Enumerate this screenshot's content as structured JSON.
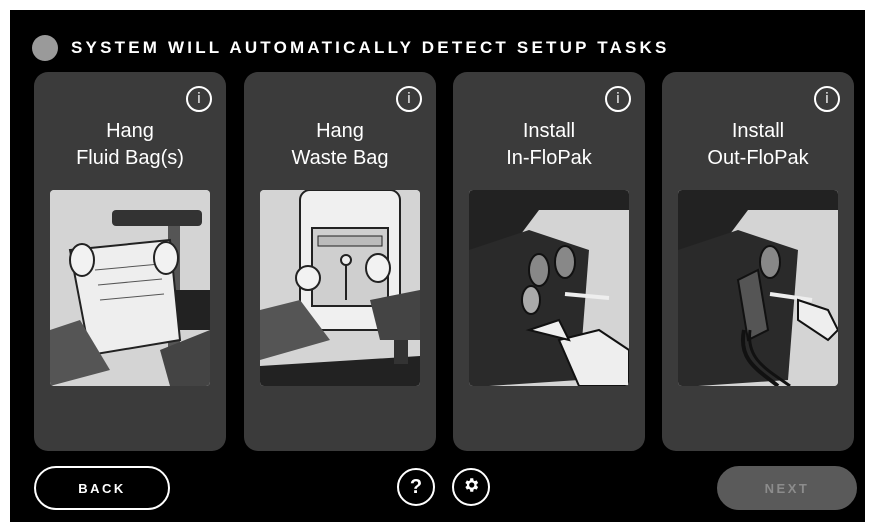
{
  "header": {
    "status_text": "SYSTEM WILL AUTOMATICALLY DETECT SETUP TASKS",
    "status_color": "#9a9a9a"
  },
  "cards": [
    {
      "title_line1": "Hang",
      "title_line2": "Fluid Bag(s)",
      "info_icon": "i",
      "image": "hands-hanging-fluid-bag"
    },
    {
      "title_line1": "Hang",
      "title_line2": "Waste Bag",
      "info_icon": "i",
      "image": "hands-hanging-waste-bag"
    },
    {
      "title_line1": "Install",
      "title_line2": "In-FloPak",
      "info_icon": "i",
      "image": "hand-installing-in-flopak"
    },
    {
      "title_line1": "Install",
      "title_line2": "Out-FloPak",
      "info_icon": "i",
      "image": "hand-installing-out-flopak"
    }
  ],
  "footer": {
    "back_label": "BACK",
    "next_label": "NEXT",
    "help_label": "?",
    "settings_icon": "gear-icon"
  },
  "colors": {
    "background": "#000000",
    "card": "#3b3b3b",
    "next_disabled": "#5a5a5a"
  }
}
